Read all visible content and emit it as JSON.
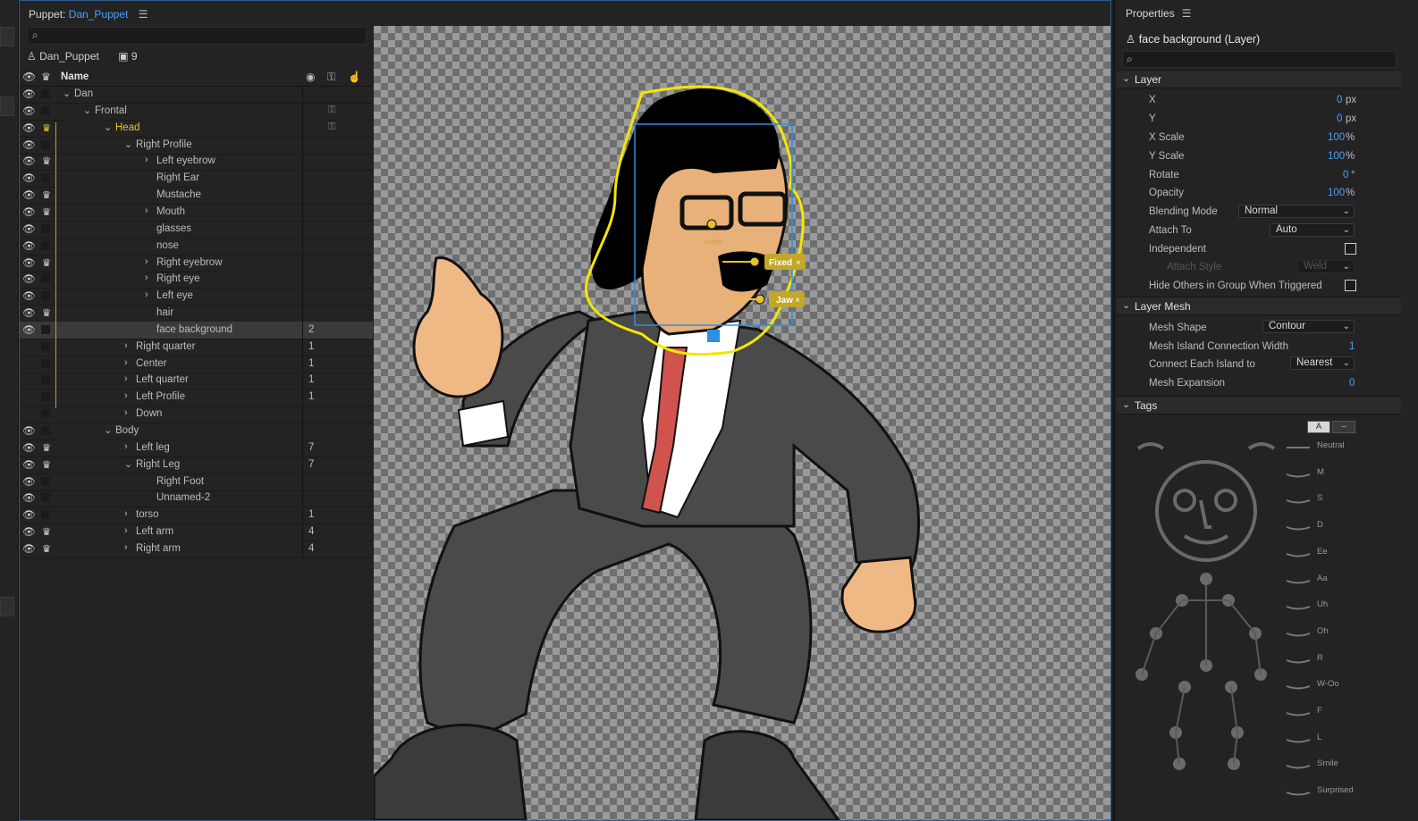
{
  "puppet_panel": {
    "title_prefix": "Puppet:",
    "puppet_name": "Dan_Puppet",
    "root_name": "Dan_Puppet",
    "root_count": "9",
    "header_name": "Name"
  },
  "tree": [
    {
      "label": "Dan",
      "indent": 0,
      "chev": "open",
      "eye": true,
      "crown": false,
      "count": ""
    },
    {
      "label": "Frontal",
      "indent": 1,
      "chev": "open",
      "eye": true,
      "crown": false,
      "count": "",
      "lock": true
    },
    {
      "label": "Head",
      "indent": 2,
      "chev": "open",
      "eye": true,
      "crown": true,
      "count": "",
      "lock": true,
      "head": true
    },
    {
      "label": "Right Profile",
      "indent": 3,
      "chev": "open",
      "eye": true,
      "crown": false,
      "count": ""
    },
    {
      "label": "Left eyebrow",
      "indent": 4,
      "chev": "closed",
      "eye": true,
      "crown": true,
      "count": ""
    },
    {
      "label": "Right Ear",
      "indent": 4,
      "chev": "",
      "eye": true,
      "crown": false,
      "count": ""
    },
    {
      "label": "Mustache",
      "indent": 4,
      "chev": "",
      "eye": true,
      "crown": true,
      "count": ""
    },
    {
      "label": "Mouth",
      "indent": 4,
      "chev": "closed",
      "eye": true,
      "crown": true,
      "count": ""
    },
    {
      "label": "glasses",
      "indent": 4,
      "chev": "",
      "eye": true,
      "crown": false,
      "count": ""
    },
    {
      "label": "nose",
      "indent": 4,
      "chev": "",
      "eye": true,
      "crown": false,
      "count": ""
    },
    {
      "label": "Right eyebrow",
      "indent": 4,
      "chev": "closed",
      "eye": true,
      "crown": true,
      "count": ""
    },
    {
      "label": "Right eye",
      "indent": 4,
      "chev": "closed",
      "eye": true,
      "crown": false,
      "count": ""
    },
    {
      "label": "Left eye",
      "indent": 4,
      "chev": "closed",
      "eye": true,
      "crown": false,
      "count": ""
    },
    {
      "label": "hair",
      "indent": 4,
      "chev": "",
      "eye": true,
      "crown": true,
      "count": ""
    },
    {
      "label": "face background",
      "indent": 4,
      "chev": "",
      "eye": true,
      "crown": false,
      "count": "2",
      "selected": true
    },
    {
      "label": "Right quarter",
      "indent": 3,
      "chev": "closed",
      "eye": false,
      "crown": false,
      "count": "1"
    },
    {
      "label": "Center",
      "indent": 3,
      "chev": "closed",
      "eye": false,
      "crown": false,
      "count": "1"
    },
    {
      "label": "Left quarter",
      "indent": 3,
      "chev": "closed",
      "eye": false,
      "crown": false,
      "count": "1"
    },
    {
      "label": "Left Profile",
      "indent": 3,
      "chev": "closed",
      "eye": false,
      "crown": false,
      "count": "1"
    },
    {
      "label": "Down",
      "indent": 3,
      "chev": "closed",
      "eye": false,
      "crown": false,
      "count": ""
    },
    {
      "label": "Body",
      "indent": 2,
      "chev": "open",
      "eye": true,
      "crown": false,
      "count": ""
    },
    {
      "label": "Left leg",
      "indent": 3,
      "chev": "closed",
      "eye": true,
      "crown": true,
      "count": "7"
    },
    {
      "label": "Right Leg",
      "indent": 3,
      "chev": "open",
      "eye": true,
      "crown": true,
      "count": "7"
    },
    {
      "label": "Right Foot",
      "indent": 4,
      "chev": "",
      "eye": true,
      "crown": false,
      "count": ""
    },
    {
      "label": "Unnamed-2",
      "indent": 4,
      "chev": "",
      "eye": true,
      "crown": false,
      "count": ""
    },
    {
      "label": "torso",
      "indent": 3,
      "chev": "closed",
      "eye": true,
      "crown": false,
      "count": "1"
    },
    {
      "label": "Left arm",
      "indent": 3,
      "chev": "closed",
      "eye": true,
      "crown": true,
      "count": "4"
    },
    {
      "label": "Right arm",
      "indent": 3,
      "chev": "closed",
      "eye": true,
      "crown": true,
      "count": "4"
    }
  ],
  "canvas": {
    "handle_origin": "origin",
    "handle_fixed": "Fixed",
    "handle_jaw": "Jaw"
  },
  "properties": {
    "title": "Properties",
    "layer_name": "face background (Layer)",
    "section_layer": "Layer",
    "x_label": "X",
    "x_value": "0",
    "x_unit": "px",
    "y_label": "Y",
    "y_value": "0",
    "y_unit": "px",
    "xscale_label": "X Scale",
    "xscale_value": "100",
    "xscale_unit": "%",
    "yscale_label": "Y Scale",
    "yscale_value": "100",
    "yscale_unit": "%",
    "rotate_label": "Rotate",
    "rotate_value": "0",
    "rotate_unit": "°",
    "opacity_label": "Opacity",
    "opacity_value": "100",
    "opacity_unit": "%",
    "blend_label": "Blending Mode",
    "blend_value": "Normal",
    "attach_label": "Attach To",
    "attach_value": "Auto",
    "independent_label": "Independent",
    "attach_style_label": "Attach Style",
    "attach_style_value": "Weld",
    "hide_others_label": "Hide Others in Group When Triggered",
    "section_mesh": "Layer Mesh",
    "mesh_shape_label": "Mesh Shape",
    "mesh_shape_value": "Contour",
    "island_width_label": "Mesh Island Connection Width",
    "island_width_value": "1",
    "connect_label": "Connect Each Island to",
    "connect_value": "Nearest",
    "expansion_label": "Mesh Expansion",
    "expansion_value": "0",
    "section_tags": "Tags",
    "tag_btn_a": "A",
    "visemes": [
      "Neutral",
      "M",
      "S",
      "D",
      "Ee",
      "Aa",
      "Uh",
      "Oh",
      "R",
      "W-Oo",
      "F",
      "L",
      "Smile",
      "Surprised"
    ]
  },
  "colors": {
    "accent": "#4aa0ff",
    "head_yellow": "#e6c230",
    "panel": "#232323",
    "outline": "#f5e600"
  }
}
